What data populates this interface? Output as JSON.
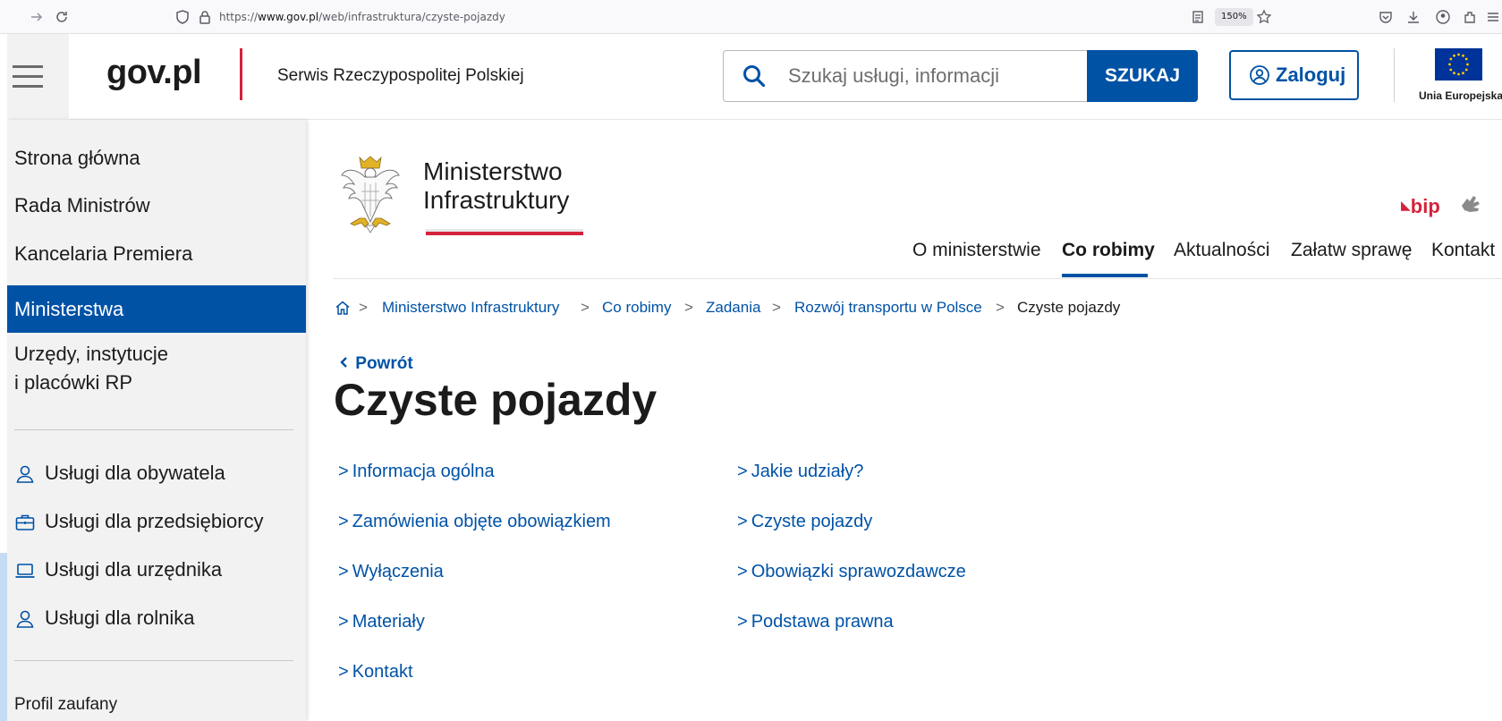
{
  "browser": {
    "url_prefix": "https://",
    "url_host": "www.gov.pl",
    "url_path": "/web/infrastruktura/czyste-pojazdy",
    "zoom": "150%"
  },
  "header": {
    "logo": "gov.pl",
    "site_name": "Serwis Rzeczypospolitej Polskiej",
    "search_placeholder": "Szukaj usługi, informacji",
    "search_button": "SZUKAJ",
    "login_button": "Zaloguj",
    "eu_label": "Unia Europejska"
  },
  "sidebar": {
    "items": [
      {
        "label": "Strona główna"
      },
      {
        "label": "Rada Ministrów"
      },
      {
        "label": "Kancelaria Premiera"
      },
      {
        "label": "Ministerstwa",
        "active": true
      }
    ],
    "institutions_line1": "Urzędy, instytucje",
    "institutions_line2": "i placówki RP",
    "services": [
      {
        "label": "Usługi dla obywatela",
        "icon": "person-icon"
      },
      {
        "label": "Usługi dla przedsiębiorcy",
        "icon": "briefcase-icon"
      },
      {
        "label": "Usługi dla urzędnika",
        "icon": "laptop-icon"
      },
      {
        "label": "Usługi dla rolnika",
        "icon": "person-icon"
      }
    ],
    "profile": "Profil zaufany"
  },
  "ministry": {
    "name_line1": "Ministerstwo",
    "name_line2": "Infrastruktury",
    "bip": "bip"
  },
  "nav": {
    "items": [
      {
        "label": "O ministerstwie"
      },
      {
        "label": "Co robimy",
        "active": true
      },
      {
        "label": "Aktualności"
      },
      {
        "label": "Załatw sprawę"
      },
      {
        "label": "Kontakt"
      }
    ]
  },
  "breadcrumb": {
    "links": [
      "Ministerstwo Infrastruktury",
      "Co robimy",
      "Zadania",
      "Rozwój transportu w Polsce"
    ],
    "current": "Czyste pojazdy",
    "separator": ">"
  },
  "page": {
    "back": "Powrót",
    "title": "Czyste pojazdy",
    "link_chevron": ">",
    "links_left": [
      "Informacja ogólna",
      "Zamówienia objęte obowiązkiem",
      "Wyłączenia",
      "Materiały",
      "Kontakt"
    ],
    "links_right": [
      "Jakie udziały?",
      "Czyste pojazdy",
      "Obowiązki sprawozdawcze",
      "Podstawa prawna"
    ]
  },
  "colors": {
    "primary": "#0052a5",
    "accent_red": "#d5233b",
    "sidebar_bg": "#f2f2f2"
  }
}
